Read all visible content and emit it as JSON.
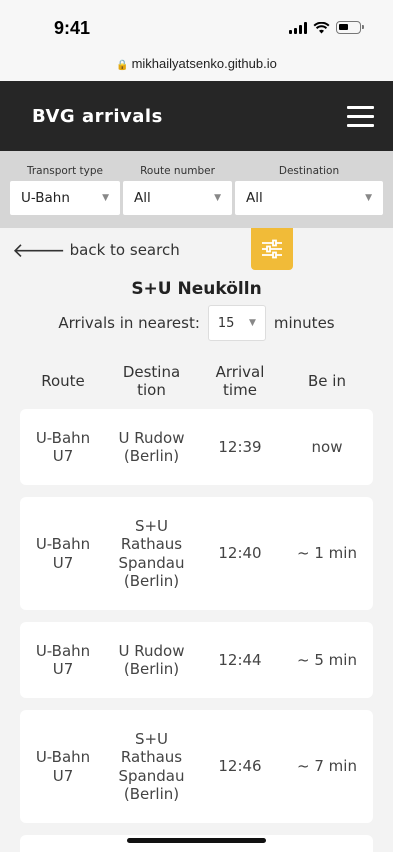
{
  "status": {
    "time": "9:41",
    "url": "mikhailyatsenko.github.io"
  },
  "header": {
    "title": "BVG arrivals"
  },
  "filters": [
    {
      "label": "Transport type",
      "value": "U-Bahn"
    },
    {
      "label": "Route number",
      "value": "All"
    },
    {
      "label": "Destination",
      "value": "All"
    }
  ],
  "nav": {
    "back_label": "back to search"
  },
  "station": {
    "name": "S+U Neukölln"
  },
  "nearest": {
    "prefix": "Arrivals in nearest:",
    "value": "15",
    "suffix": "minutes"
  },
  "table": {
    "headers": {
      "route": "Route",
      "destination": "Destina tion",
      "arrival": "Arrival time",
      "be_in": "Be in"
    },
    "rows": [
      {
        "route_type": "U-Bahn",
        "route_line": "U7",
        "destination": "U Rudow (Berlin)",
        "arrival": "12:39",
        "be_in": "now"
      },
      {
        "route_type": "U-Bahn",
        "route_line": "U7",
        "destination": "S+U Rathaus Spandau (Berlin)",
        "arrival": "12:40",
        "be_in": "~ 1 min"
      },
      {
        "route_type": "U-Bahn",
        "route_line": "U7",
        "destination": "U Rudow (Berlin)",
        "arrival": "12:44",
        "be_in": "~ 5 min"
      },
      {
        "route_type": "U-Bahn",
        "route_line": "U7",
        "destination": "S+U Rathaus Spandau (Berlin)",
        "arrival": "12:46",
        "be_in": "~ 7 min"
      }
    ]
  },
  "colors": {
    "header_bg": "#262626",
    "filter_bg": "#d6d6d6",
    "accent": "#f1bb38",
    "page_bg": "#f3f3f3"
  }
}
